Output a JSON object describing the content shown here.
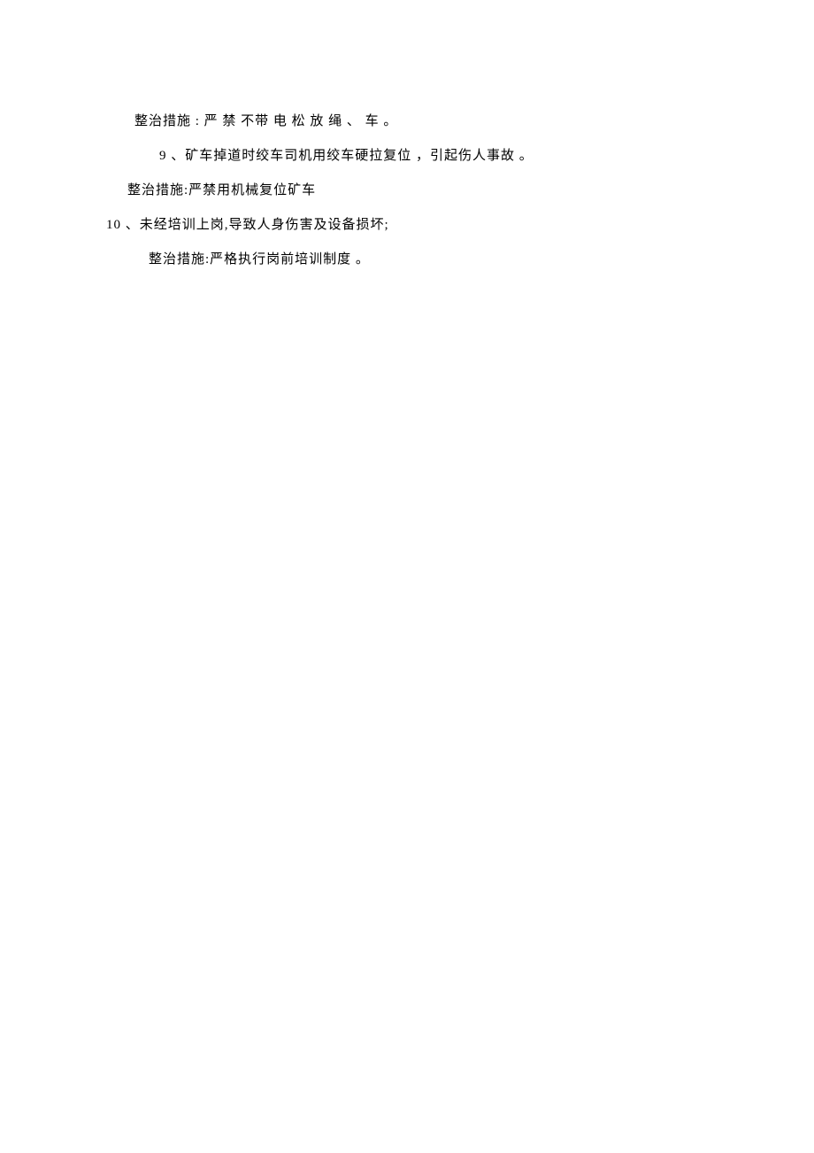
{
  "lines": [
    {
      "text": "整治措施 : 严 禁 不带 电 松 放 绳 、 车 。",
      "indent": "indent-1"
    },
    {
      "text": "9 、矿车掉道时绞车司机用绞车硬拉复位 ，引起伤人事故 。",
      "indent": "indent-2"
    },
    {
      "text": "整治措施:严禁用机械复位矿车",
      "indent": "indent-3"
    },
    {
      "text": "10 、未经培训上岗,导致人身伤害及设备损坏;",
      "indent": "indent-0"
    },
    {
      "text": "整治措施:严格执行岗前培训制度 。",
      "indent": "indent-4"
    }
  ]
}
